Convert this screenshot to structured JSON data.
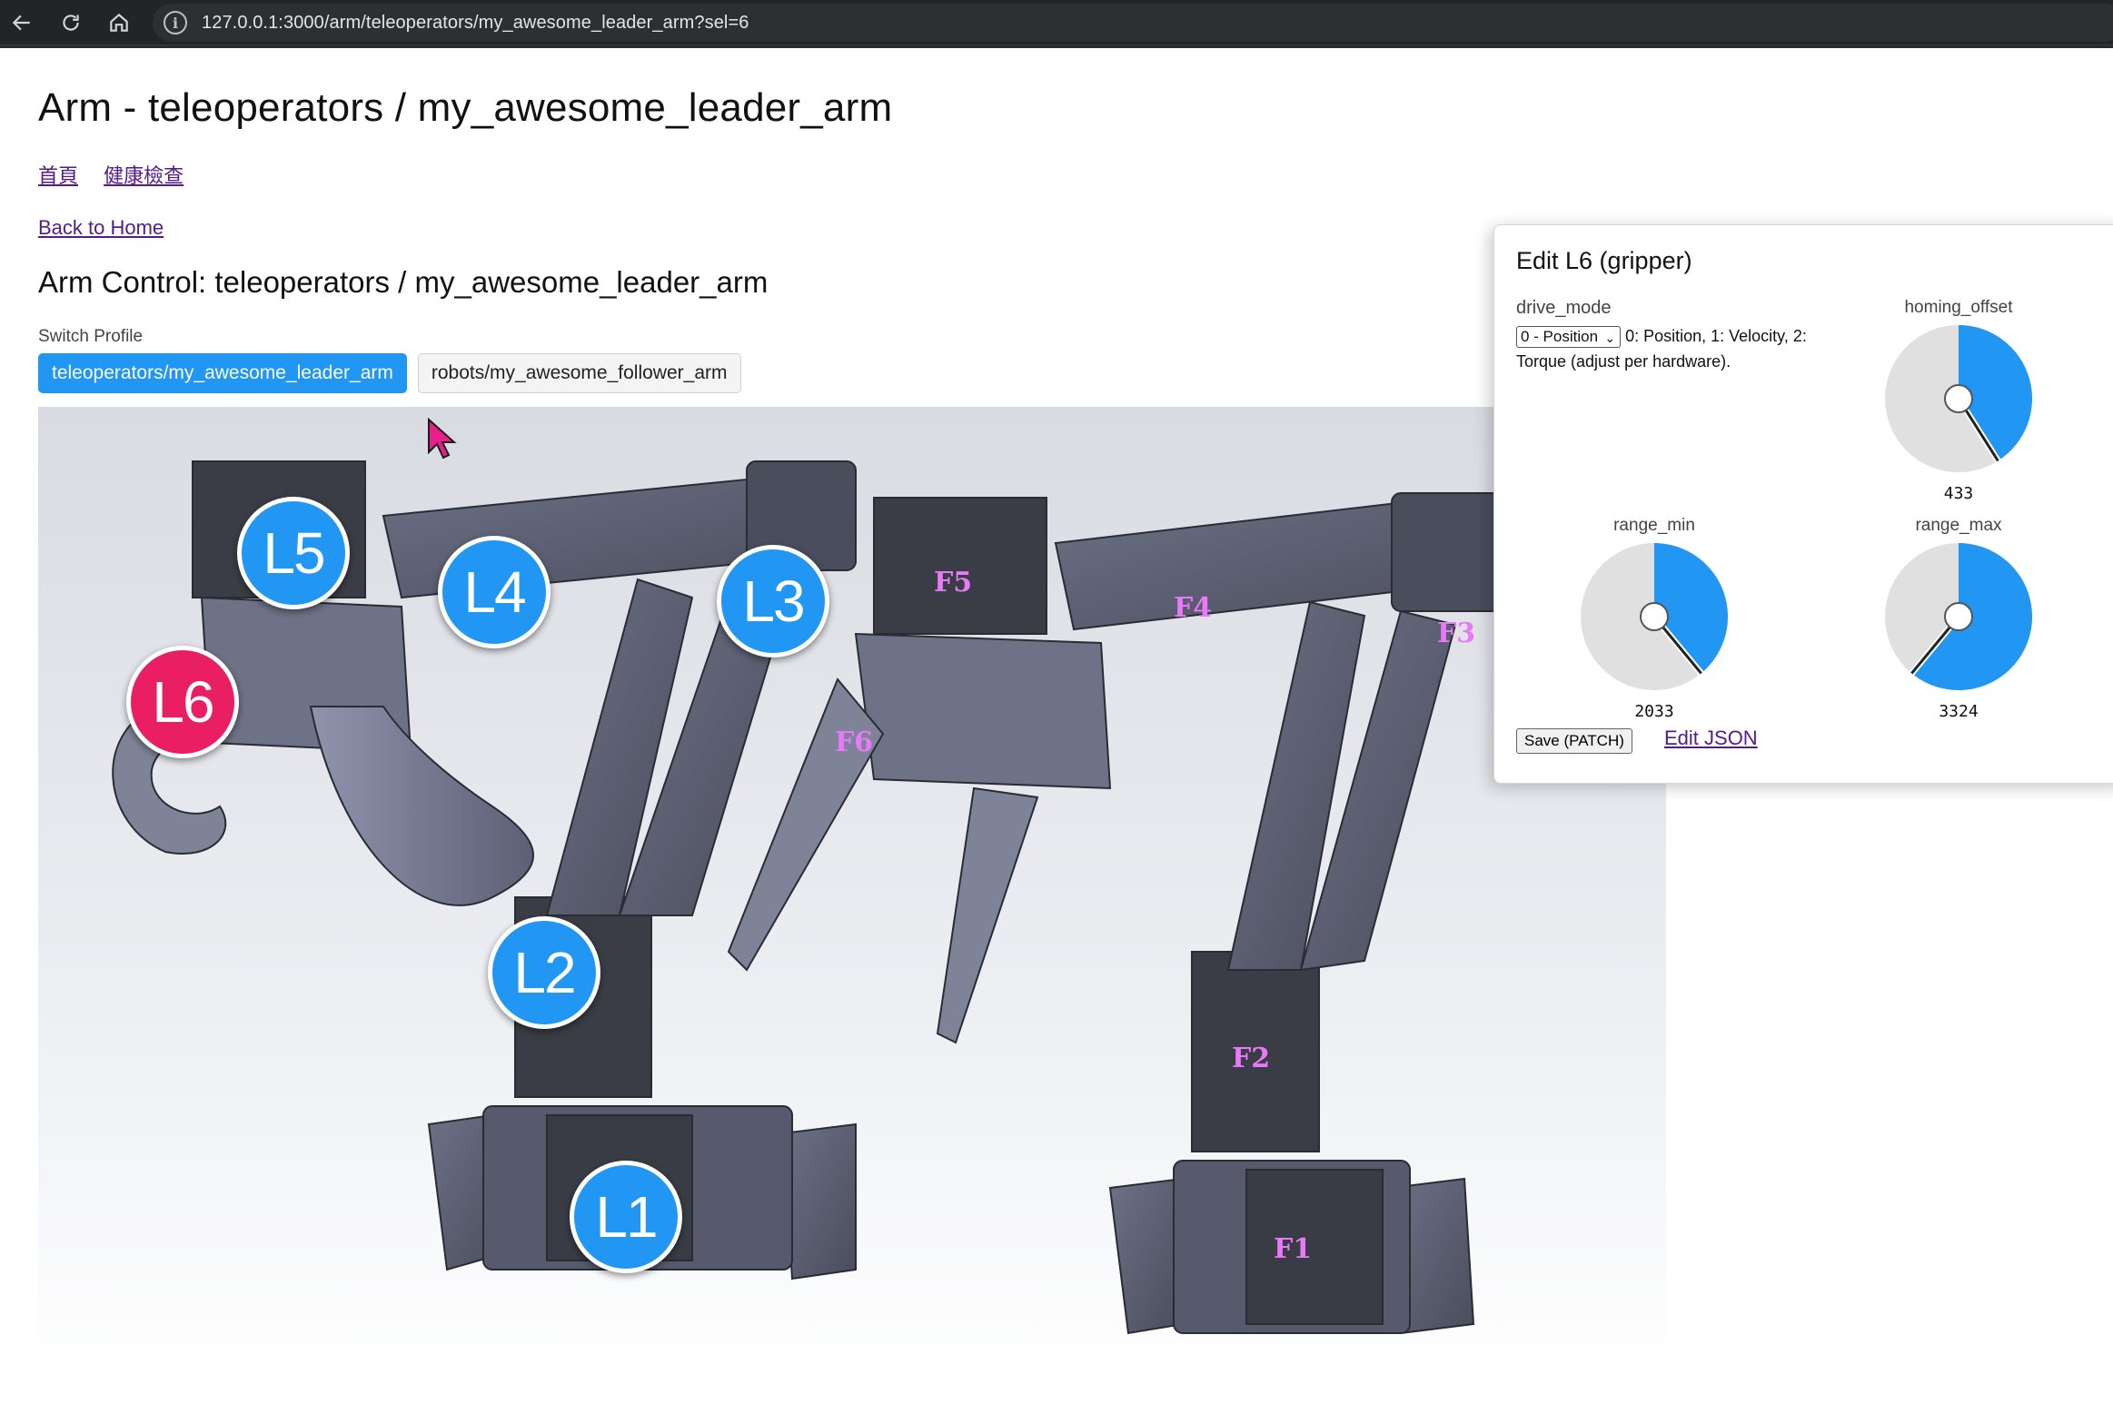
{
  "browser": {
    "url": "127.0.0.1:3000/arm/teleoperators/my_awesome_leader_arm?sel=6",
    "back_icon": "arrow-left-icon",
    "reload_icon": "reload-icon",
    "home_icon": "home-icon",
    "info_icon": "info-icon"
  },
  "page": {
    "title": "Arm - teleoperators / my_awesome_leader_arm",
    "nav": [
      "首頁",
      "健康檢查"
    ],
    "back_link": "Back to Home",
    "section_title": "Arm Control: teleoperators / my_awesome_leader_arm",
    "switch_profile_label": "Switch Profile",
    "profiles": [
      {
        "label": "teleoperators/my_awesome_leader_arm",
        "active": true
      },
      {
        "label": "robots/my_awesome_follower_arm",
        "active": false
      }
    ]
  },
  "arm_image": {
    "leader_badges": [
      {
        "label": "L5",
        "selected": false
      },
      {
        "label": "L4",
        "selected": false
      },
      {
        "label": "L3",
        "selected": false
      },
      {
        "label": "L6",
        "selected": true
      },
      {
        "label": "L2",
        "selected": false
      },
      {
        "label": "L1",
        "selected": false
      }
    ],
    "follower_labels": [
      "F5",
      "F4",
      "F3",
      "F6",
      "F2",
      "F1"
    ]
  },
  "edit_panel": {
    "title": "Edit L6 (gripper)",
    "drive_mode": {
      "label": "drive_mode",
      "selected": "0 - Position",
      "help": "0: Position, 1: Velocity, 2: Torque (adjust per hardware)."
    },
    "gauges": [
      {
        "label": "homing_offset",
        "value": 433,
        "fill_fraction": 0.41
      },
      {
        "label": "range_min",
        "value": 2033,
        "fill_fraction": 0.39
      },
      {
        "label": "range_max",
        "value": 3324,
        "fill_fraction": 0.61
      }
    ],
    "save_label": "Save (PATCH)",
    "edit_json_label": "Edit JSON"
  },
  "colors": {
    "accent": "#2196f3",
    "selected_badge": "#e91e63",
    "follower_label": "#e879f9",
    "link": "#551a8b"
  }
}
